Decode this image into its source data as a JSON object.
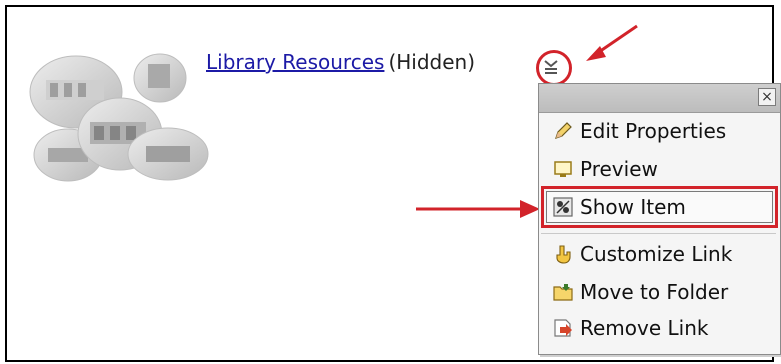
{
  "item": {
    "link_text": "Library Resources",
    "status_text": "(Hidden)"
  },
  "menu": {
    "close_label": "×",
    "items": [
      {
        "label": "Edit Properties",
        "icon": "pencil-icon"
      },
      {
        "label": "Preview",
        "icon": "preview-icon"
      },
      {
        "label": "Show Item",
        "icon": "show-item-icon"
      },
      {
        "label": "Customize Link",
        "icon": "customize-link-icon"
      },
      {
        "label": "Move to Folder",
        "icon": "folder-icon"
      },
      {
        "label": "Remove Link",
        "icon": "remove-link-icon"
      }
    ]
  },
  "annotation": {
    "color": "#d2232a"
  }
}
